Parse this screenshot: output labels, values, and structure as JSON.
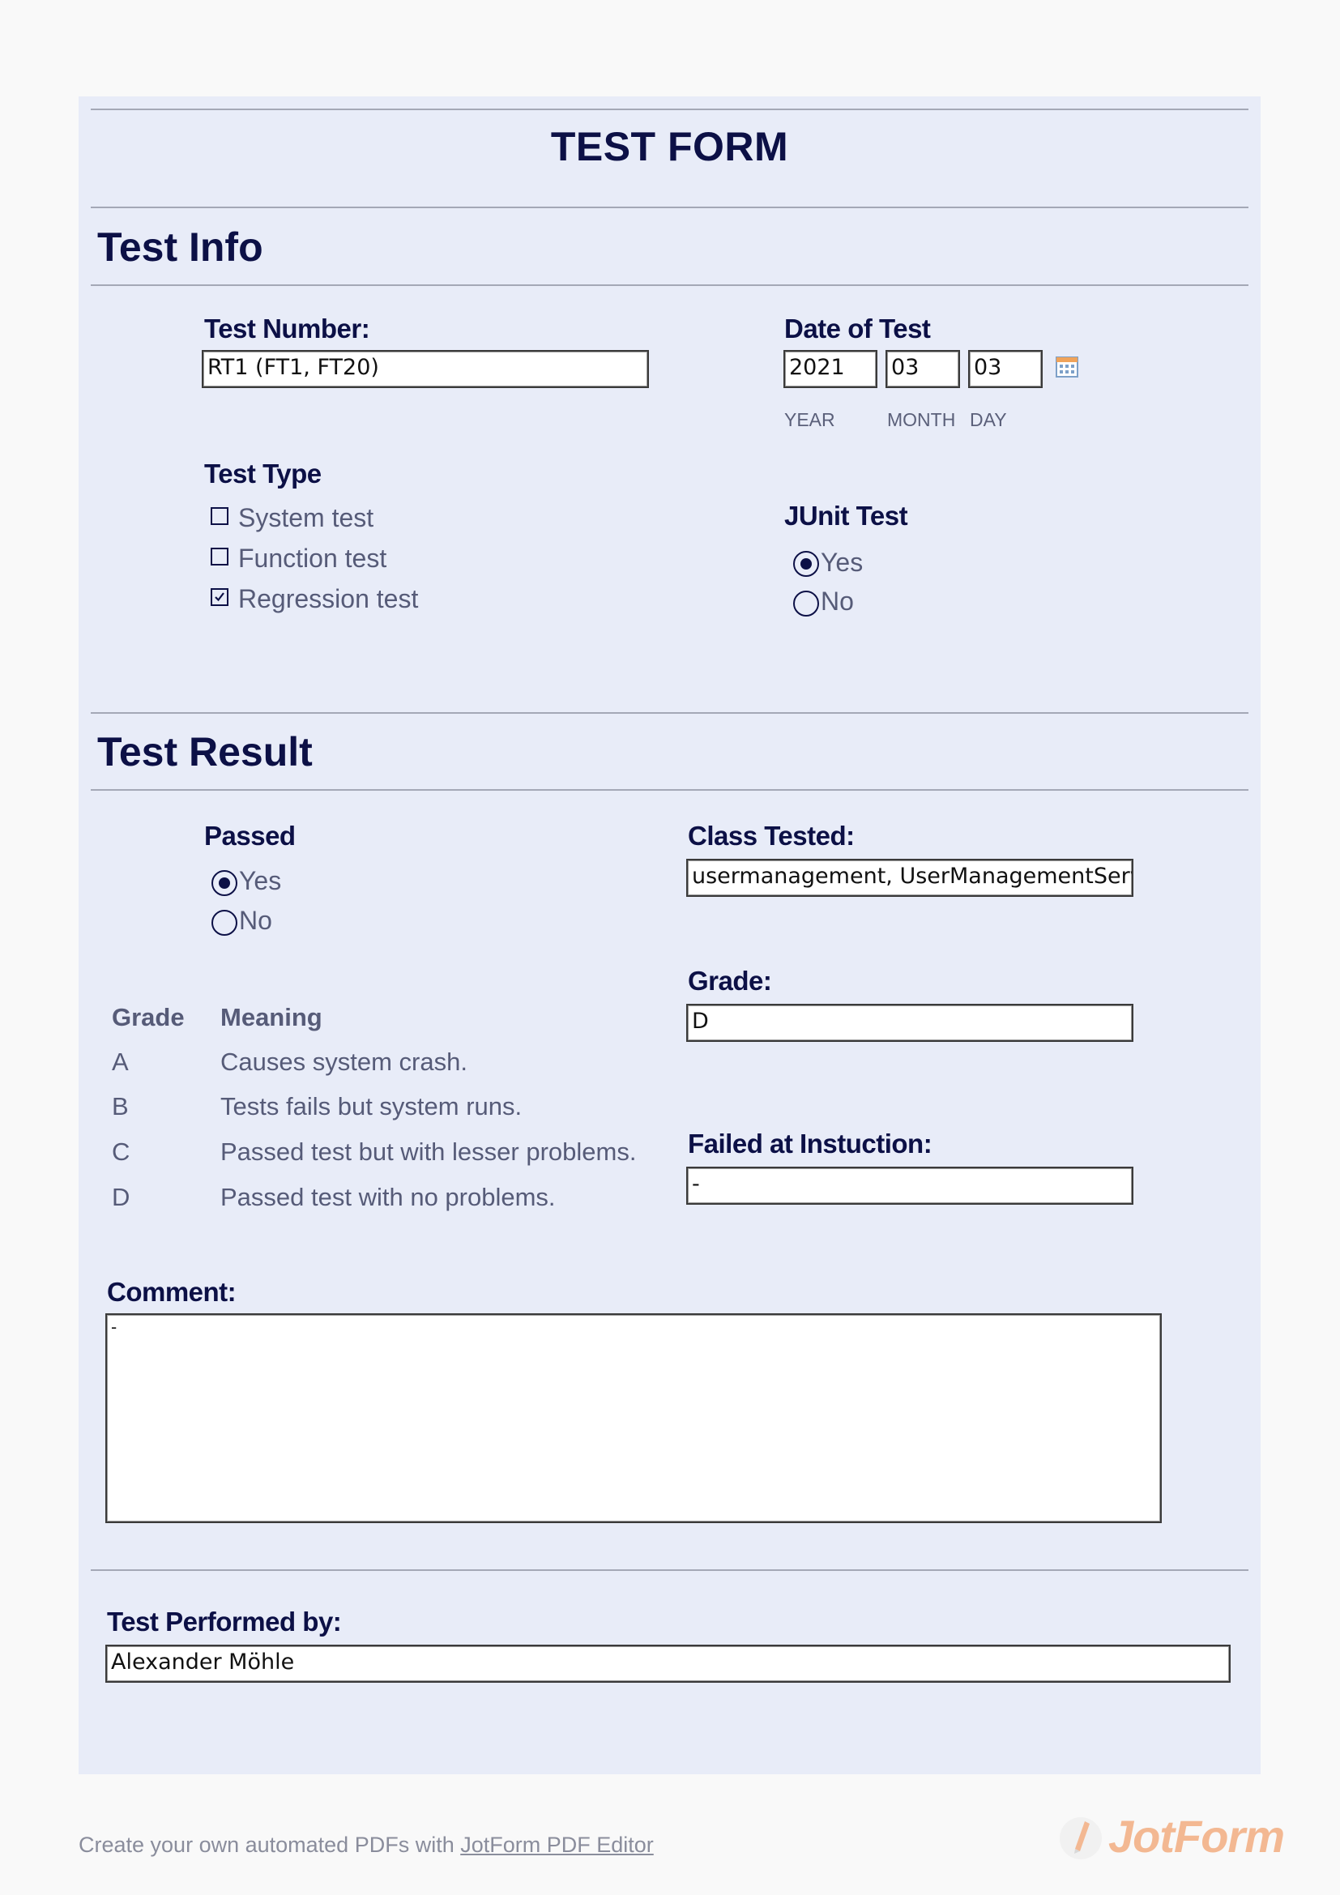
{
  "form": {
    "title": "TEST FORM"
  },
  "sections": {
    "test_info": "Test Info",
    "test_result": "Test Result"
  },
  "test_number": {
    "label": "Test Number:",
    "value": "RT1 (FT1, FT20)"
  },
  "date_of_test": {
    "label": "Date of Test",
    "year": "2021",
    "month": "03",
    "day": "03",
    "year_label": "YEAR",
    "month_label": "MONTH",
    "day_label": "DAY",
    "calendar_icon": "calendar-icon"
  },
  "test_type": {
    "label": "Test Type",
    "options": [
      {
        "label": "System test",
        "checked": false
      },
      {
        "label": "Function test",
        "checked": false
      },
      {
        "label": "Regression test",
        "checked": true
      }
    ]
  },
  "junit_test": {
    "label": "JUnit Test",
    "options": [
      {
        "label": "Yes",
        "selected": true
      },
      {
        "label": "No",
        "selected": false
      }
    ]
  },
  "passed": {
    "label": "Passed",
    "options": [
      {
        "label": "Yes",
        "selected": true
      },
      {
        "label": "No",
        "selected": false
      }
    ]
  },
  "class_tested": {
    "label": "Class Tested:",
    "value": "usermanagement, UserManagementServlet"
  },
  "grade_table": {
    "headers": [
      "Grade",
      "Meaning"
    ],
    "rows": [
      [
        "A",
        "Causes system crash."
      ],
      [
        "B",
        "Tests fails but system runs."
      ],
      [
        "C",
        "Passed test but with lesser problems."
      ],
      [
        "D",
        "Passed test with no problems."
      ]
    ]
  },
  "grade": {
    "label": "Grade:",
    "value": "D"
  },
  "failed_at": {
    "label": "Failed at Instuction:",
    "value": "-"
  },
  "comment": {
    "label": "Comment:",
    "value": "-"
  },
  "performed_by": {
    "label": "Test Performed by:",
    "value": "Alexander Möhle"
  },
  "footer": {
    "text": "Create your own automated PDFs with ",
    "link": "JotForm PDF Editor",
    "brand": "JotForm"
  },
  "colors": {
    "panel": "#e8ecf8",
    "ink": "#0c1046",
    "muted": "#565b78",
    "brand": "#f3b892"
  }
}
